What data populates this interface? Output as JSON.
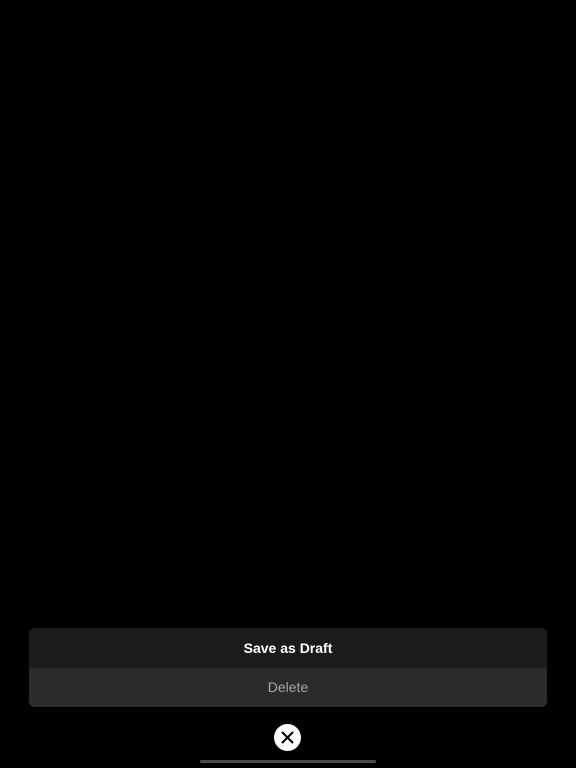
{
  "action_sheet": {
    "options": [
      {
        "label": "Save as Draft"
      },
      {
        "label": "Delete"
      }
    ]
  },
  "close_button": {
    "icon": "close-icon"
  },
  "colors": {
    "background": "#000000",
    "sheet_primary": "#1c1c1c",
    "sheet_secondary": "#2b2b2b",
    "primary_text": "#ffffff",
    "secondary_text": "#a6a6a6",
    "close_button_bg": "#ffffff",
    "home_indicator": "#4a4a4a"
  }
}
